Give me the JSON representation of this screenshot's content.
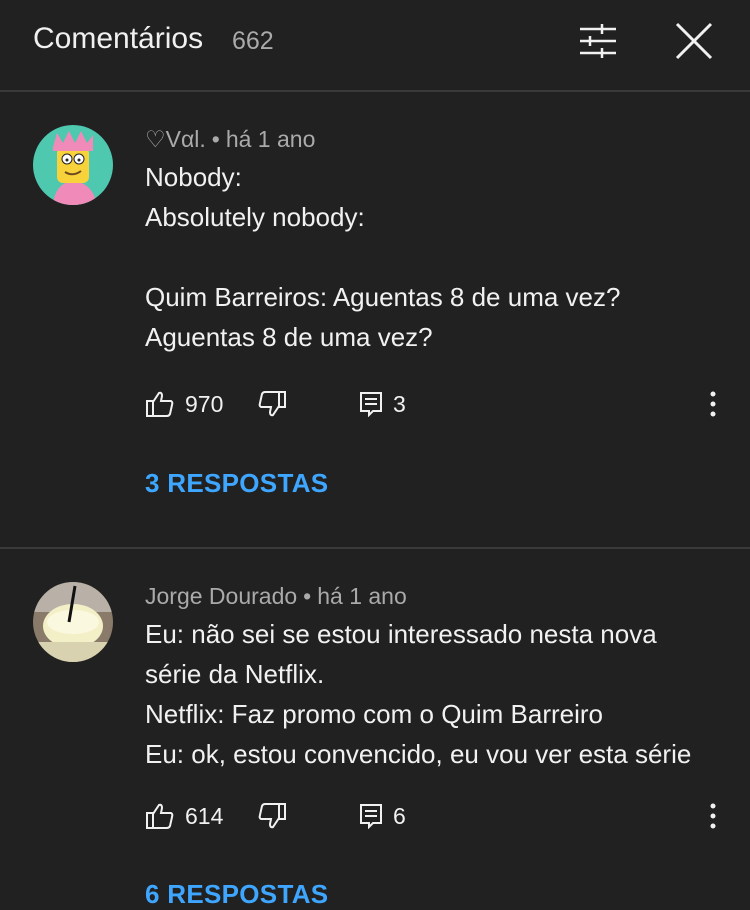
{
  "header": {
    "title": "Comentários",
    "count": "662",
    "filter_icon": "filter-sliders-icon",
    "close_icon": "close-icon"
  },
  "comments": [
    {
      "author": "♡Vαl.",
      "time": "há 1 ano",
      "body": "Nobody:\nAbsolutely nobody:\n\nQuim Barreiros: Aguentas 8 de uma vez?\nAguentas 8 de uma vez?",
      "likes": "970",
      "reply_count": "3",
      "replies_link": "3 RESPOSTAS"
    },
    {
      "author": "Jorge Dourado",
      "time": "há 1 ano",
      "body": "Eu: não sei se estou interessado nesta nova\nsérie da Netflix.\nNetflix: Faz promo com o Quim Barreiro\nEu: ok, estou convencido, eu vou ver esta série",
      "likes": "614",
      "reply_count": "6",
      "replies_link": "6 RESPOSTAS"
    }
  ],
  "colors": {
    "background": "#212121",
    "link": "#3ea6ff",
    "secondary_text": "#aaaaaa"
  }
}
